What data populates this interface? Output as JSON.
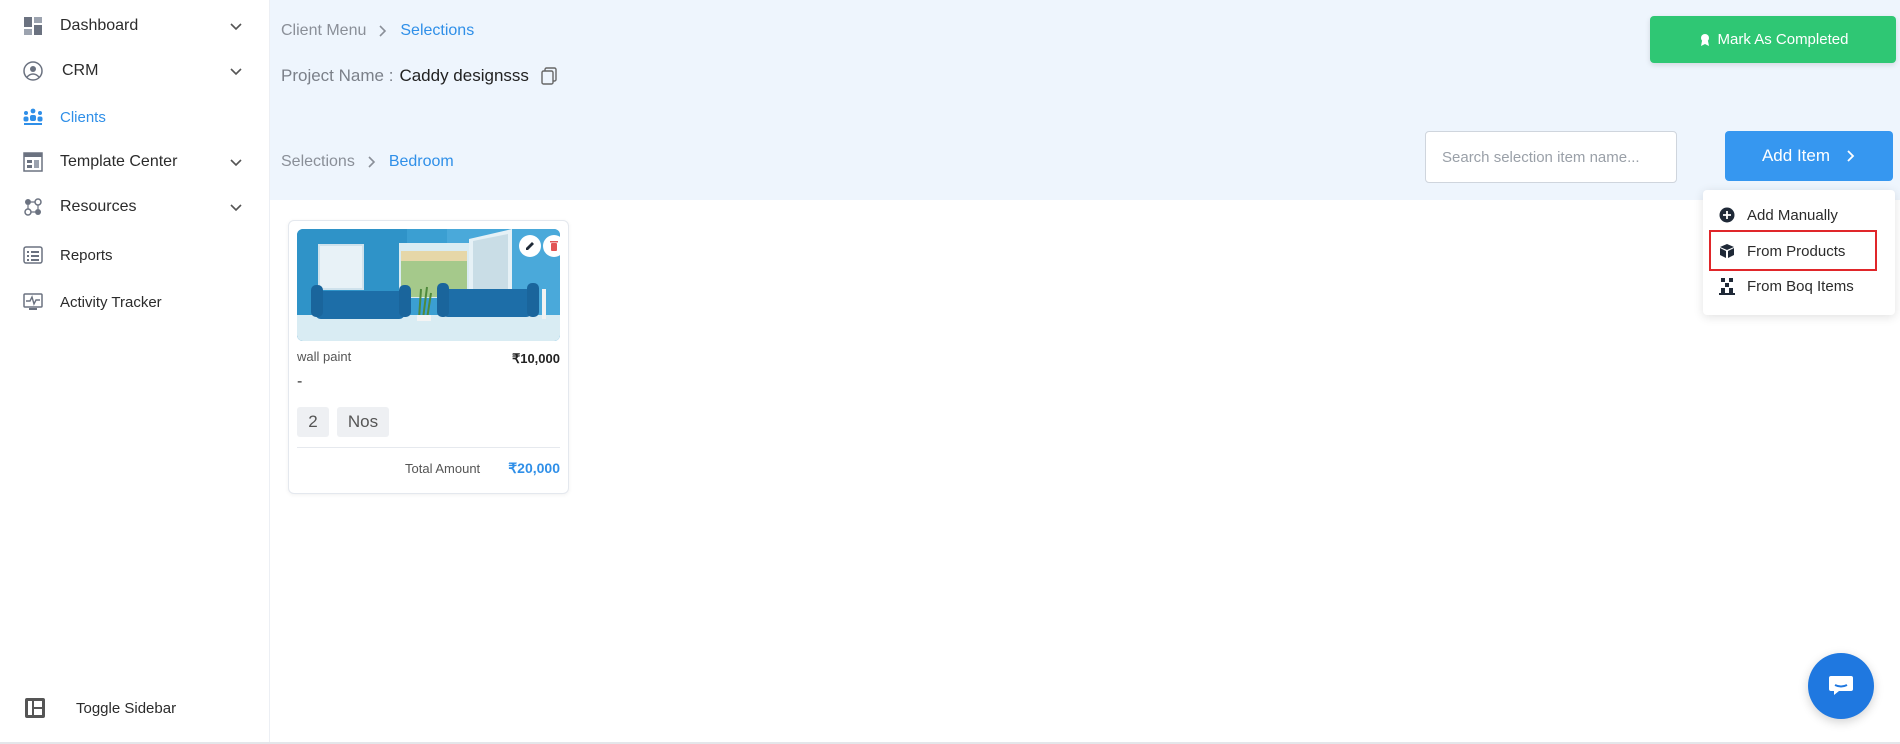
{
  "sidebar": {
    "items": [
      {
        "label": "Dashboard",
        "icon": "dashboard-icon",
        "has_chevron": true
      },
      {
        "label": "CRM",
        "icon": "crm-icon",
        "has_chevron": true
      },
      {
        "label": "Clients",
        "icon": "clients-icon",
        "active": true
      },
      {
        "label": "Template Center",
        "icon": "template-icon",
        "has_chevron": true
      },
      {
        "label": "Resources",
        "icon": "resources-icon",
        "has_chevron": true
      },
      {
        "label": "Reports",
        "icon": "reports-icon"
      },
      {
        "label": "Activity Tracker",
        "icon": "activity-icon"
      }
    ],
    "toggle_label": "Toggle Sidebar"
  },
  "header": {
    "breadcrumb": {
      "parent": "Client Menu",
      "current": "Selections"
    },
    "project_label": "Project Name :",
    "project_name": "Caddy designsss",
    "mark_completed_label": "Mark As Completed",
    "sub_breadcrumb": {
      "parent": "Selections",
      "current": "Bedroom"
    },
    "search_placeholder": "Search selection item name...",
    "add_item_label": "Add Item"
  },
  "dropdown": {
    "items": [
      {
        "label": "Add Manually",
        "icon": "plus-circle-icon"
      },
      {
        "label": "From Products",
        "icon": "products-icon",
        "highlighted": true
      },
      {
        "label": "From Boq Items",
        "icon": "boq-icon"
      }
    ]
  },
  "card": {
    "name": "wall paint",
    "price": "₹10,000",
    "description": "-",
    "quantity": "2",
    "unit": "Nos",
    "total_label": "Total Amount",
    "total_value": "₹20,000"
  },
  "colors": {
    "accent": "#2f8fe8",
    "success": "#2fc774",
    "header_bg": "#eef5fd",
    "highlight": "#e0262a"
  }
}
